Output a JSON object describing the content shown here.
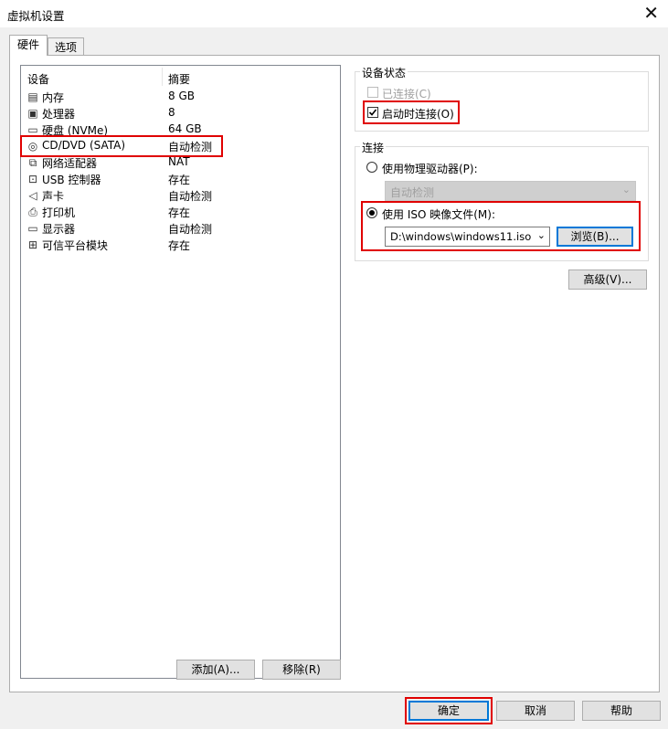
{
  "window": {
    "title": "虚拟机设置",
    "close_glyph": "✕"
  },
  "tabs": [
    {
      "label": "硬件"
    },
    {
      "label": "选项"
    }
  ],
  "devices": {
    "col_device": "设备",
    "col_summary": "摘要",
    "rows": [
      {
        "icon": "memory-icon",
        "name": "内存",
        "summary": "8 GB"
      },
      {
        "icon": "cpu-icon",
        "name": "处理器",
        "summary": "8"
      },
      {
        "icon": "disk-icon",
        "name": "硬盘 (NVMe)",
        "summary": "64 GB"
      },
      {
        "icon": "cd-icon",
        "name": "CD/DVD (SATA)",
        "summary": "自动检测"
      },
      {
        "icon": "network-icon",
        "name": "网络适配器",
        "summary": "NAT"
      },
      {
        "icon": "usb-icon",
        "name": "USB 控制器",
        "summary": "存在"
      },
      {
        "icon": "sound-icon",
        "name": "声卡",
        "summary": "自动检测"
      },
      {
        "icon": "printer-icon",
        "name": "打印机",
        "summary": "存在"
      },
      {
        "icon": "display-icon",
        "name": "显示器",
        "summary": "自动检测"
      },
      {
        "icon": "tpm-icon",
        "name": "可信平台模块",
        "summary": "存在"
      }
    ],
    "add_button": "添加(A)...",
    "remove_button": "移除(R)"
  },
  "device_status": {
    "label": "设备状态",
    "connected": "已连接(C)",
    "connect_at_power_on": "启动时连接(O)"
  },
  "connection": {
    "label": "连接",
    "physical_drive": "使用物理驱动器(P):",
    "physical_drive_value": "自动检测",
    "iso_image": "使用 ISO 映像文件(M):",
    "iso_path": "D:\\windows\\windows11.iso",
    "browse_button": "浏览(B)...",
    "advanced_button": "高级(V)..."
  },
  "footer": {
    "ok": "确定",
    "cancel": "取消",
    "help": "帮助"
  }
}
